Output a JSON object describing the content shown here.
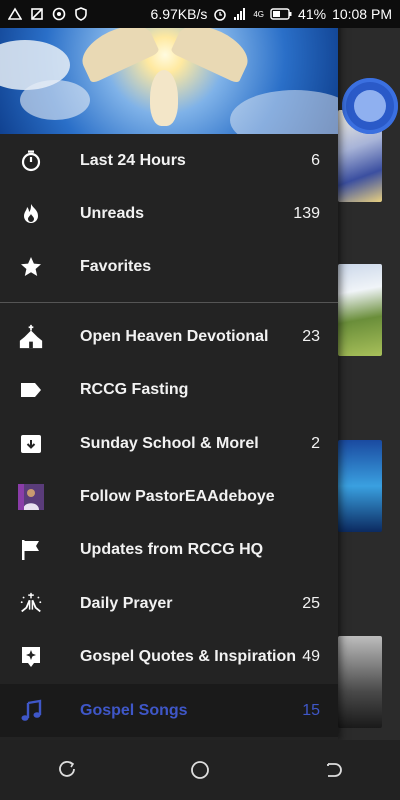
{
  "status_bar": {
    "speed": "6.97KB/s",
    "network": "4G",
    "battery": "41%",
    "time": "10:08 PM"
  },
  "drawer": {
    "header_image": "dove-in-sky",
    "items": [
      {
        "label": "Last 24 Hours",
        "count": "6",
        "icon": "stopwatch-icon"
      },
      {
        "label": "Unreads",
        "count": "139",
        "icon": "flame-icon"
      },
      {
        "label": "Favorites",
        "count": "",
        "icon": "star-icon"
      },
      {
        "label": "Open Heaven Devotional",
        "count": "23",
        "icon": "church-icon"
      },
      {
        "label": "RCCG Fasting",
        "count": "",
        "icon": "tag-icon"
      },
      {
        "label": "Sunday School & Morel",
        "count": "2",
        "icon": "archive-icon"
      },
      {
        "label": "Follow PastorEAAdeboye",
        "count": "",
        "icon": "pastor-avatar-icon"
      },
      {
        "label": "Updates from RCCG HQ",
        "count": "",
        "icon": "flag-icon"
      },
      {
        "label": "Daily Prayer",
        "count": "25",
        "icon": "praying-hands-icon"
      },
      {
        "label": "Gospel Quotes & Inspiration",
        "count": "49",
        "icon": "quote-sparkle-icon"
      },
      {
        "label": "Gospel Songs",
        "count": "15",
        "icon": "music-note-icon"
      }
    ]
  },
  "colors": {
    "drawer_bg": "#232323",
    "active_accent": "#3f57c8",
    "text": "#f2f2f2"
  },
  "nav_bar": {
    "buttons": [
      "recent-apps-icon",
      "home-icon",
      "back-icon"
    ]
  }
}
